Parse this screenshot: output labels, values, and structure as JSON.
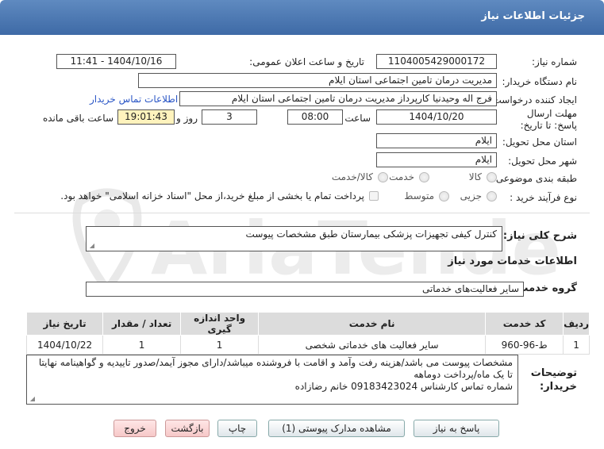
{
  "header": {
    "title": "جزئیات اطلاعات نیاز"
  },
  "form": {
    "need_number_label": "شماره نیاز:",
    "need_number": "1104005429000172",
    "announce_label": "تاریخ و ساعت اعلان عمومی:",
    "announce_value": "1404/10/16 - 11:41",
    "buyer_org_label": "نام دستگاه خریدار:",
    "buyer_org": "مدیریت درمان تامین اجتماعی استان ایلام",
    "requester_label": "ایجاد کننده درخواست:",
    "requester": "فرج اله وحیدنیا کارپرداز مدیریت درمان تامین اجتماعی استان ایلام",
    "contact_link": "اطلاعات تماس خریدار",
    "deadline_label": "مهلت ارسال پاسخ: تا تاریخ:",
    "deadline_date": "1404/10/20",
    "time_label": "ساعت",
    "deadline_time": "08:00",
    "days_value": "3",
    "days_label": "روز و",
    "remaining_time": "19:01:43",
    "remaining_label": "ساعت باقی مانده",
    "province_label": "استان محل تحویل:",
    "province": "ایلام",
    "city_label": "شهر محل تحویل:",
    "city": "ایلام",
    "category_label": "طبقه بندی موضوعی:",
    "category_options": [
      "کالا",
      "خدمت",
      "کالا/خدمت"
    ],
    "process_label": "نوع فرآیند خرید :",
    "process_options": [
      "جزیی",
      "متوسط"
    ],
    "payment_note": "پرداخت تمام یا بخشی از مبلغ خرید،از محل \"اسناد خزانه اسلامی\" خواهد بود."
  },
  "summary": {
    "label": "شرح کلی نیاز:",
    "value": "کنترل کیفی تجهیزات پزشکی بیمارستان طبق مشخصات پیوست"
  },
  "services": {
    "section_title": "اطلاعات خدمات مورد نیاز",
    "group_label": "گروه خدمت:",
    "group_value": "سایر فعالیت‌های خدماتی",
    "columns": [
      "ردیف",
      "کد خدمت",
      "نام خدمت",
      "واحد اندازه گیری",
      "تعداد / مقدار",
      "تاریخ نیاز"
    ],
    "rows": [
      {
        "row": "1",
        "code": "ط-96-960",
        "name": "سایر فعالیت های خدماتی شخصی",
        "unit": "1",
        "qty": "1",
        "date": "1404/10/22"
      }
    ]
  },
  "buyer_notes": {
    "label": "توضیحات خریدار:",
    "lines": [
      "مشخصات پیوست می باشد/هزینه رفت وآمد و اقامت با فروشنده میباشد/دارای مجوز آیمد/صدور تاییدیه و گواهینامه نهایتا تا یک ماه/پرداخت دوماهه",
      "شماره تماس کارشناس 09183423024 خانم رضازاده"
    ]
  },
  "buttons": {
    "reply": "پاسخ به نیاز",
    "attachments": "مشاهده مدارک پیوستی (1)",
    "print": "چاپ",
    "back": "بازگشت",
    "exit": "خروج"
  }
}
